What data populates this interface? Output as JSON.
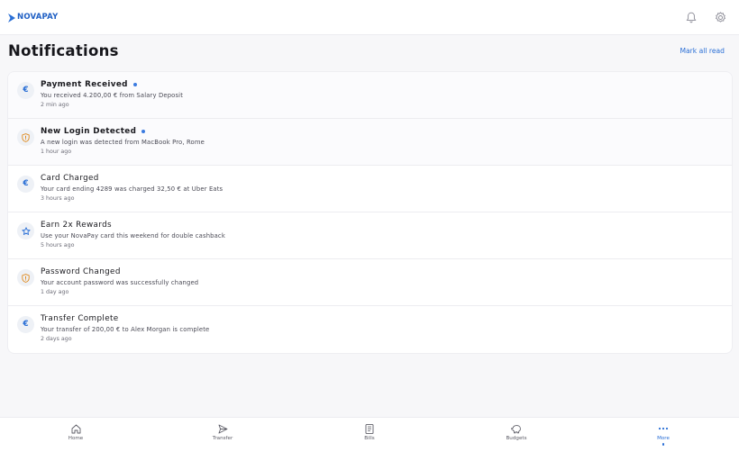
{
  "app": {
    "brand": "NOVAPAY"
  },
  "header": {
    "title": "Notifications",
    "mark_all": "Mark all read"
  },
  "colors": {
    "accent": "#2a6fd6",
    "euro": "#2a6fd6",
    "shield": "#e08a1e",
    "star": "#2a6fd6",
    "unread_dot": "#3b7be0"
  },
  "notifications": [
    {
      "icon": "euro-icon",
      "glyph": "€",
      "title": "Payment Received",
      "body": "You received 4.200,00 € from Salary Deposit",
      "time": "2 min ago",
      "unread": true
    },
    {
      "icon": "shield-icon",
      "glyph": "",
      "title": "New Login Detected",
      "body": "A new login was detected from MacBook Pro, Rome",
      "time": "1 hour ago",
      "unread": true
    },
    {
      "icon": "euro-icon",
      "glyph": "€",
      "title": "Card Charged",
      "body": "Your card ending 4289 was charged 32,50 € at Uber Eats",
      "time": "3 hours ago",
      "unread": false
    },
    {
      "icon": "star-icon",
      "glyph": "",
      "title": "Earn 2x Rewards",
      "body": "Use your NovaPay card this weekend for double cashback",
      "time": "5 hours ago",
      "unread": false
    },
    {
      "icon": "shield-icon",
      "glyph": "",
      "title": "Password Changed",
      "body": "Your account password was successfully changed",
      "time": "1 day ago",
      "unread": false
    },
    {
      "icon": "euro-icon",
      "glyph": "€",
      "title": "Transfer Complete",
      "body": "Your transfer of 200,00 € to Alex Morgan is complete",
      "time": "2 days ago",
      "unread": false
    }
  ],
  "nav": [
    {
      "label": "Home",
      "icon": "home-icon",
      "active": false
    },
    {
      "label": "Transfer",
      "icon": "send-icon",
      "active": false
    },
    {
      "label": "Bills",
      "icon": "bill-icon",
      "active": false
    },
    {
      "label": "Budgets",
      "icon": "piggy-bank-icon",
      "active": false
    },
    {
      "label": "More",
      "icon": "more-icon",
      "active": true
    }
  ]
}
